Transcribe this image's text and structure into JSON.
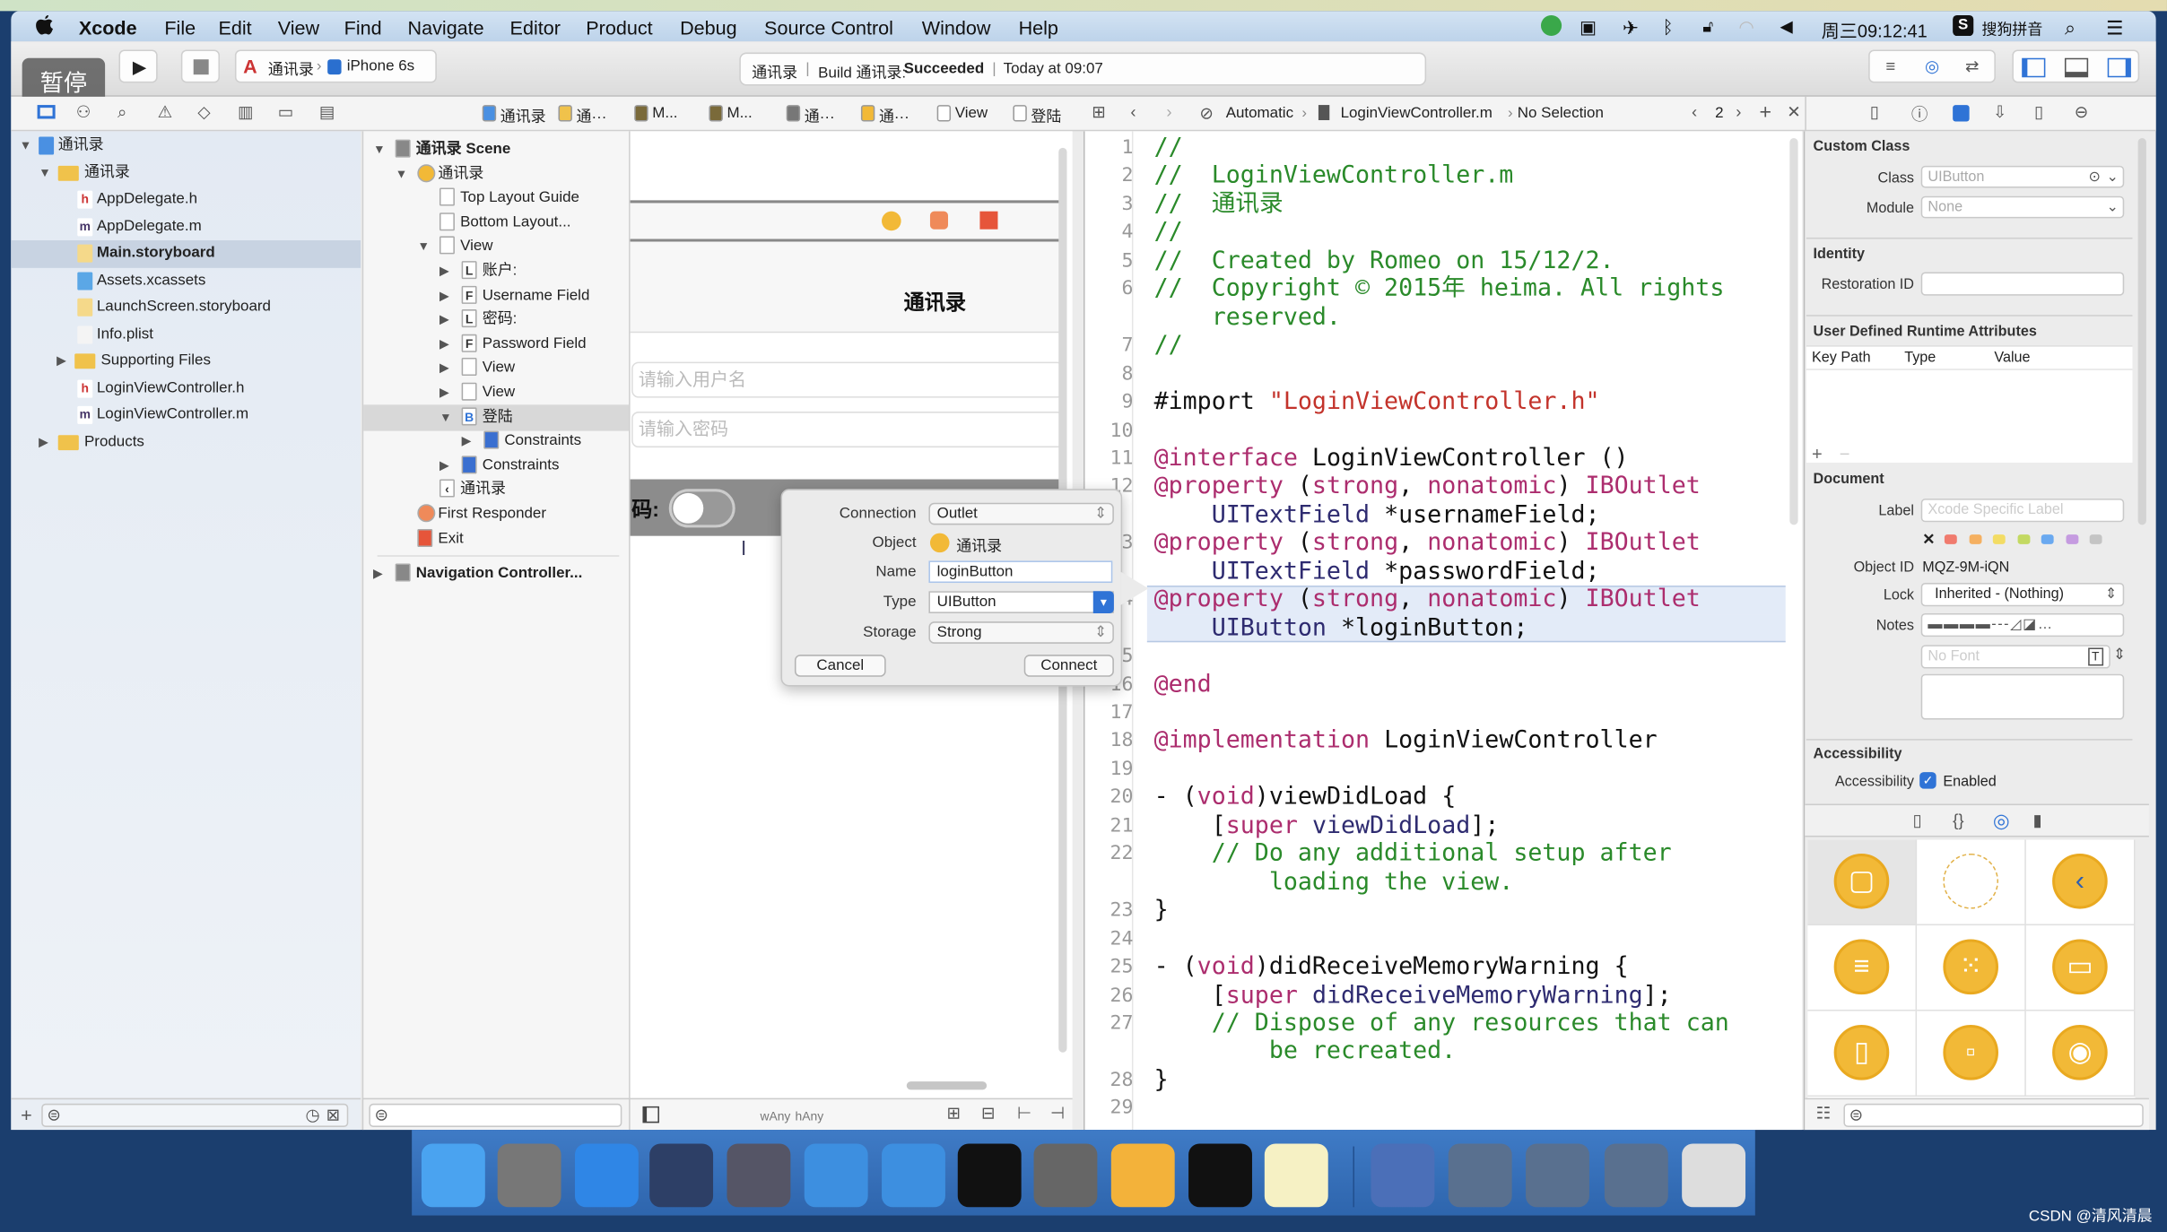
{
  "menubar": {
    "app": "Xcode",
    "items": [
      "File",
      "Edit",
      "View",
      "Find",
      "Navigate",
      "Editor",
      "Product",
      "Debug",
      "Source Control",
      "Window",
      "Help"
    ],
    "clock": "周三09:12:41",
    "ime": "搜狗拼音"
  },
  "overlay": {
    "pause_label": "暂停"
  },
  "toolbar": {
    "scheme": "通讯录",
    "device": "iPhone 6s",
    "status_project": "通讯录",
    "status_build": "Build 通讯录:",
    "status_result": "Succeeded",
    "status_time": "Today at 09:07"
  },
  "canvas_breadcrumb": [
    "通讯录",
    "通···",
    "M...",
    "M...",
    "通···",
    "通···",
    "View",
    "登陆"
  ],
  "editor_jumpbar": {
    "mode": "Automatic",
    "file": "LoginViewController.m",
    "selection": "No Selection",
    "counter": "2"
  },
  "navigator": [
    {
      "label": "通讯录",
      "level": 0,
      "tri": "▼",
      "icon": "project",
      "bold": false
    },
    {
      "label": "通讯录",
      "level": 1,
      "tri": "▼",
      "icon": "folder"
    },
    {
      "label": "AppDelegate.h",
      "level": 2,
      "icon": "h"
    },
    {
      "label": "AppDelegate.m",
      "level": 2,
      "icon": "m"
    },
    {
      "label": "Main.storyboard",
      "level": 2,
      "icon": "storyboard",
      "selected": true
    },
    {
      "label": "Assets.xcassets",
      "level": 2,
      "icon": "assets"
    },
    {
      "label": "LaunchScreen.storyboard",
      "level": 2,
      "icon": "storyboard"
    },
    {
      "label": "Info.plist",
      "level": 2,
      "icon": "plist"
    },
    {
      "label": "Supporting Files",
      "level": 1.5,
      "tri": "▶",
      "icon": "folder"
    },
    {
      "label": "LoginViewController.h",
      "level": 2,
      "icon": "h"
    },
    {
      "label": "LoginViewController.m",
      "level": 2,
      "icon": "m"
    },
    {
      "label": "Products",
      "level": 1,
      "tri": "▶",
      "icon": "folder"
    }
  ],
  "outline": [
    {
      "label": "通讯录 Scene",
      "x": 0,
      "tri": "▼",
      "icon": "scene",
      "bold": true
    },
    {
      "label": "通讯录",
      "x": 1,
      "tri": "▼",
      "icon": "vc"
    },
    {
      "label": "Top Layout Guide",
      "x": 2,
      "icon": "box"
    },
    {
      "label": "Bottom Layout...",
      "x": 2,
      "icon": "box"
    },
    {
      "label": "View",
      "x": 2,
      "tri": "▼",
      "icon": "box"
    },
    {
      "label": "账户:",
      "x": 3,
      "tri": "▶",
      "icon": "L"
    },
    {
      "label": "Username Field",
      "x": 3,
      "tri": "▶",
      "icon": "F"
    },
    {
      "label": "密码:",
      "x": 3,
      "tri": "▶",
      "icon": "L"
    },
    {
      "label": "Password Field",
      "x": 3,
      "tri": "▶",
      "icon": "F"
    },
    {
      "label": "View",
      "x": 3,
      "tri": "▶",
      "icon": "box"
    },
    {
      "label": "View",
      "x": 3,
      "tri": "▶",
      "icon": "box"
    },
    {
      "label": "登陆",
      "x": 3,
      "tri": "▼",
      "icon": "B",
      "selected": true
    },
    {
      "label": "Constraints",
      "x": 4,
      "tri": "▶",
      "icon": "constraints"
    },
    {
      "label": "Constraints",
      "x": 3,
      "tri": "▶",
      "icon": "constraints"
    },
    {
      "label": "通讯录",
      "x": 2,
      "icon": "back"
    },
    {
      "label": "First Responder",
      "x": 1,
      "icon": "responder"
    },
    {
      "label": "Exit",
      "x": 1,
      "icon": "exit"
    },
    {
      "label": "Navigation Controller...",
      "x": 0,
      "tri": "▶",
      "icon": "scene",
      "bold": true,
      "gap": true
    }
  ],
  "canvas": {
    "nav_title": "通讯录",
    "username_placeholder": "请输入用户名",
    "password_placeholder": "请输入密码",
    "switch_label": "码:",
    "switch_on": false,
    "size_class_w": "wAny",
    "size_class_h": "hAny"
  },
  "popover": {
    "connection_label": "Connection",
    "connection_value": "Outlet",
    "object_label": "Object",
    "object_value": "通讯录",
    "name_label": "Name",
    "name_value": "loginButton",
    "type_label": "Type",
    "type_value": "UIButton",
    "storage_label": "Storage",
    "storage_value": "Strong",
    "cancel": "Cancel",
    "connect": "Connect"
  },
  "code": [
    {
      "n": "1",
      "s": [
        [
          "c",
          "//"
        ]
      ]
    },
    {
      "n": "2",
      "s": [
        [
          "c",
          "//  LoginViewController.m"
        ]
      ]
    },
    {
      "n": "3",
      "s": [
        [
          "c",
          "//  通讯录"
        ]
      ]
    },
    {
      "n": "4",
      "s": [
        [
          "c",
          "//"
        ]
      ]
    },
    {
      "n": "5",
      "s": [
        [
          "c",
          "//  Created by Romeo on 15/12/2."
        ]
      ]
    },
    {
      "n": "6",
      "s": [
        [
          "c",
          "//  Copyright © 2015年 heima. All rights"
        ]
      ]
    },
    {
      "n": "",
      "s": [
        [
          "c",
          "    reserved."
        ]
      ]
    },
    {
      "n": "7",
      "s": [
        [
          "c",
          "//"
        ]
      ]
    },
    {
      "n": "8",
      "s": []
    },
    {
      "n": "9",
      "s": [
        [
          "p",
          "#import "
        ],
        [
          "s",
          "\"LoginViewController.h\""
        ]
      ]
    },
    {
      "n": "10",
      "s": []
    },
    {
      "n": "11",
      "s": [
        [
          "k",
          "@interface"
        ],
        [
          "p",
          " LoginViewController ()"
        ]
      ]
    },
    {
      "n": "12",
      "s": [
        [
          "k",
          "@property"
        ],
        [
          "p",
          " ("
        ],
        [
          "k",
          "strong"
        ],
        [
          "p",
          ", "
        ],
        [
          "k",
          "nonatomic"
        ],
        [
          "p",
          ") "
        ],
        [
          "k",
          "IBOutlet"
        ]
      ]
    },
    {
      "n": "",
      "s": [
        [
          "t",
          "    UITextField"
        ],
        [
          "p",
          " *usernameField;"
        ]
      ]
    },
    {
      "n": "13",
      "s": [
        [
          "k",
          "@property"
        ],
        [
          "p",
          " ("
        ],
        [
          "k",
          "strong"
        ],
        [
          "p",
          ", "
        ],
        [
          "k",
          "nonatomic"
        ],
        [
          "p",
          ") "
        ],
        [
          "k",
          "IBOutlet"
        ]
      ]
    },
    {
      "n": "",
      "s": [
        [
          "t",
          "    UITextField"
        ],
        [
          "p",
          " *passwordField;"
        ]
      ]
    },
    {
      "n": "14",
      "s": [
        [
          "k",
          "@property"
        ],
        [
          "p",
          " ("
        ],
        [
          "k",
          "strong"
        ],
        [
          "p",
          ", "
        ],
        [
          "k",
          "nonatomic"
        ],
        [
          "p",
          ") "
        ],
        [
          "k",
          "IBOutlet"
        ]
      ],
      "hl": true
    },
    {
      "n": "",
      "s": [
        [
          "t",
          "    UIButton"
        ],
        [
          "p",
          " *loginButton;"
        ]
      ],
      "hl": true
    },
    {
      "n": "15",
      "s": []
    },
    {
      "n": "16",
      "s": [
        [
          "k",
          "@end"
        ]
      ]
    },
    {
      "n": "17",
      "s": []
    },
    {
      "n": "18",
      "s": [
        [
          "k",
          "@implementation"
        ],
        [
          "p",
          " LoginViewController"
        ]
      ]
    },
    {
      "n": "19",
      "s": []
    },
    {
      "n": "20",
      "s": [
        [
          "p",
          "- ("
        ],
        [
          "k",
          "void"
        ],
        [
          "p",
          ")viewDidLoad {"
        ]
      ]
    },
    {
      "n": "21",
      "s": [
        [
          "p",
          "    ["
        ],
        [
          "k",
          "super"
        ],
        [
          "t",
          " viewDidLoad"
        ],
        [
          "p",
          "];"
        ]
      ]
    },
    {
      "n": "22",
      "s": [
        [
          "c",
          "    // Do any additional setup after"
        ]
      ]
    },
    {
      "n": "",
      "s": [
        [
          "c",
          "        loading the view."
        ]
      ]
    },
    {
      "n": "23",
      "s": [
        [
          "p",
          "}"
        ]
      ]
    },
    {
      "n": "24",
      "s": []
    },
    {
      "n": "25",
      "s": [
        [
          "p",
          "- ("
        ],
        [
          "k",
          "void"
        ],
        [
          "p",
          ")didReceiveMemoryWarning {"
        ]
      ]
    },
    {
      "n": "26",
      "s": [
        [
          "p",
          "    ["
        ],
        [
          "k",
          "super"
        ],
        [
          "t",
          " didReceiveMemoryWarning"
        ],
        [
          "p",
          "];"
        ]
      ]
    },
    {
      "n": "27",
      "s": [
        [
          "c",
          "    // Dispose of any resources that can"
        ]
      ]
    },
    {
      "n": "",
      "s": [
        [
          "c",
          "        be recreated."
        ]
      ]
    },
    {
      "n": "28",
      "s": [
        [
          "p",
          "}"
        ]
      ]
    },
    {
      "n": "29",
      "s": []
    }
  ],
  "inspector": {
    "custom_class": "Custom Class",
    "class_label": "Class",
    "class_placeholder": "UIButton",
    "module_label": "Module",
    "module_placeholder": "None",
    "identity": "Identity",
    "restoration_label": "Restoration ID",
    "restoration_value": "",
    "udra": "User Defined Runtime Attributes",
    "col_keypath": "Key Path",
    "col_type": "Type",
    "col_value": "Value",
    "document": "Document",
    "label_label": "Label",
    "label_placeholder": "Xcode Specific Label",
    "label_colors": [
      "#f07b6e",
      "#f5b061",
      "#f3dc64",
      "#c3d962",
      "#6aa9f0",
      "#c59be0",
      "#c4c4c4"
    ],
    "object_id_label": "Object ID",
    "object_id": "MQZ-9M-iQN",
    "lock_label": "Lock",
    "lock_value": "Inherited - (Nothing)",
    "notes_label": "Notes",
    "font_placeholder": "No Font",
    "accessibility": "Accessibility",
    "accessibility_label": "Accessibility",
    "enabled": "Enabled",
    "enabled_checked": true
  },
  "library": {
    "items": [
      "view-controller",
      "storyboard-reference",
      "navigation-controller",
      "table-view-controller",
      "collection-view-controller",
      "tab-bar-controller",
      "split-view-controller",
      "page-view-controller",
      "glkit-view-controller"
    ]
  },
  "dock": [
    "Finder",
    "Launchpad",
    "Safari",
    "Mouse",
    "Photo Booth",
    "Xcode",
    "Simulator",
    "Terminal",
    "System Preferences",
    "Sketch",
    "Console",
    "Notes",
    "Media Player",
    "Window 1",
    "Window 2",
    "Window 3",
    "Trash"
  ],
  "watermark": "CSDN @清风清晨",
  "colors": {
    "accent": "#2f73d6",
    "library_yellow": "#f2b937",
    "selection": "#c8d3e2"
  }
}
